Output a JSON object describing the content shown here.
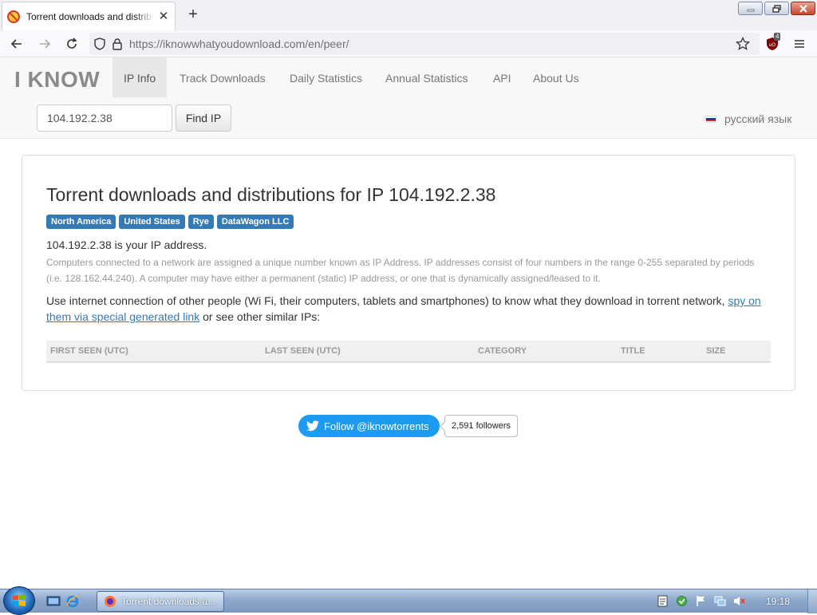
{
  "browser": {
    "tab_title": "Torrent downloads and distributions for IP 104.192.2.38",
    "url_host": "https://iknowwhatyoudownload.com",
    "url_path": "/en/peer/",
    "ublock_count": "4"
  },
  "site": {
    "brand": "I KNOW",
    "nav": [
      {
        "label": "IP Info",
        "active": true
      },
      {
        "label": "Track Downloads"
      },
      {
        "label": "Daily Statistics"
      },
      {
        "label": "Annual Statistics"
      },
      {
        "label": "API"
      },
      {
        "label": "About Us"
      }
    ],
    "search": {
      "value": "104.192.2.38",
      "button": "Find IP"
    },
    "language": "русский язык"
  },
  "main": {
    "heading": "Torrent downloads and distributions for IP 104.192.2.38",
    "badges": [
      "North America",
      "United States",
      "Rye",
      "DataWagon LLC"
    ],
    "your_ip": "104.192.2.38 is your IP address.",
    "explanation": "Computers connected to a network are assigned a unique number known as IP Address. IP addresses consist of four numbers in the range 0-255 separated by periods (i.e. 128.162.44.240). A computer may have either a permanent (static) IP address, or one that is dynamically assigned/leased to it.",
    "spy_text_before": "Use internet connection of other people (Wi Fi, their computers, tablets and smartphones) to know what they download in torrent network,",
    "spy_link": "spy on them via special generated link",
    "spy_text_after": "or see other similar IPs:",
    "table_headers": [
      "First seen (UTC)",
      "Last seen (UTC)",
      "Category",
      "Title",
      "Size"
    ]
  },
  "twitter": {
    "follow_label": "Follow @iknowtorrents",
    "followers": "2,591 followers"
  },
  "taskbar": {
    "task_title": "Torrent downloads a...",
    "clock": "19:18"
  },
  "colors": {
    "badge": "#337ab7",
    "link": "#337ab7",
    "twitter": "#1d9bf0"
  }
}
